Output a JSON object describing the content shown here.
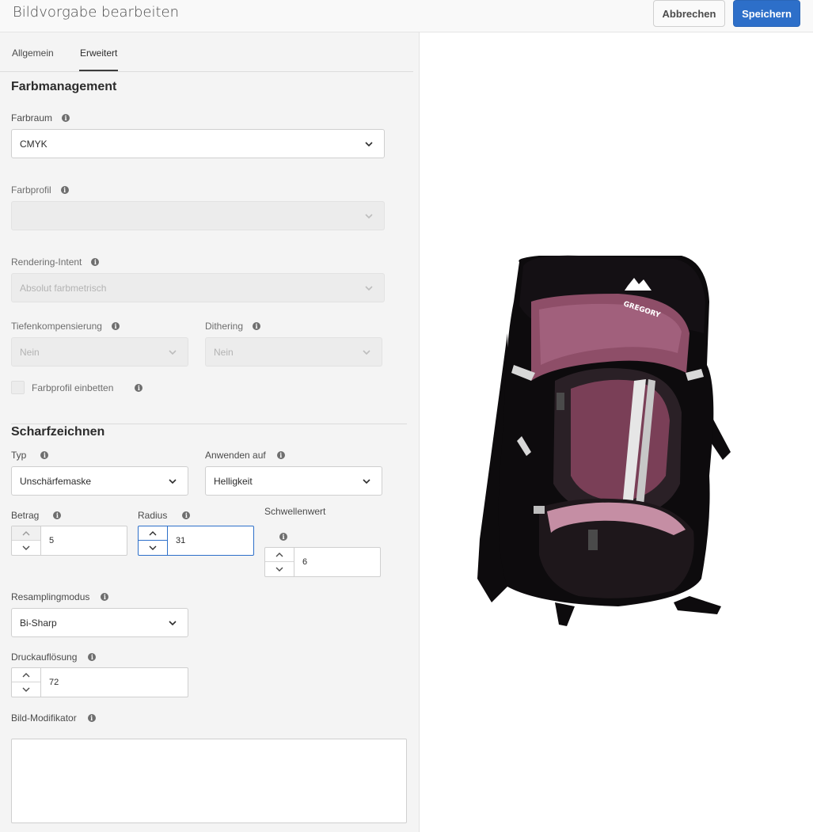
{
  "header": {
    "title": "Bildvorgabe bearbeiten",
    "cancel_label": "Abbrechen",
    "save_label": "Speichern"
  },
  "tabs": [
    {
      "label": "Allgemein",
      "active": false
    },
    {
      "label": "Erweitert",
      "active": true
    }
  ],
  "color_management": {
    "title": "Farbmanagement",
    "colorspace": {
      "label": "Farbraum",
      "value": "CMYK"
    },
    "profile": {
      "label": "Farbprofil",
      "value": ""
    },
    "rendering_intent": {
      "label": "Rendering-Intent",
      "value": "Absolut farbmetrisch"
    },
    "depth_compensation": {
      "label": "Tiefenkompensierung",
      "value": "Nein"
    },
    "dithering": {
      "label": "Dithering",
      "value": "Nein"
    },
    "embed_profile": {
      "label": "Farbprofil einbetten",
      "checked": false
    }
  },
  "sharpening": {
    "title": "Scharfzeichnen",
    "type": {
      "label": "Typ",
      "value": "Unschärfemaske"
    },
    "apply_to": {
      "label": "Anwenden auf",
      "value": "Helligkeit"
    },
    "amount": {
      "label": "Betrag",
      "value": "5"
    },
    "radius": {
      "label": "Radius",
      "value": "31"
    },
    "threshold": {
      "label": "Schwellenwert",
      "value": "6"
    },
    "resampling": {
      "label": "Resamplingmodus",
      "value": "Bi-Sharp"
    },
    "print_resolution": {
      "label": "Druckauflösung",
      "value": "72"
    },
    "image_modifier": {
      "label": "Bild-Modifikator",
      "value": ""
    }
  },
  "preview": {
    "brand_text": "GREGORY",
    "colors": {
      "body": "#0d0b0d",
      "accent": "#8e4e68",
      "accent_light": "#c58ea4"
    }
  },
  "colors": {
    "primary": "#2d6fc9",
    "panel_bg": "#f4f4f4"
  }
}
